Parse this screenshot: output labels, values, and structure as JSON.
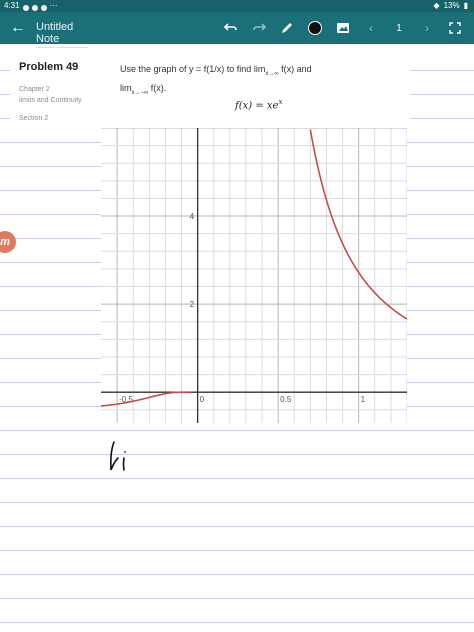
{
  "status_bar": {
    "time": "4:31",
    "battery": "13%"
  },
  "app_bar": {
    "title": "Untitled Note",
    "page_number": "1",
    "icons": [
      "back-arrow-icon",
      "undo-icon",
      "redo-icon",
      "pen-icon",
      "color-swatch",
      "image-icon",
      "prev-page-icon",
      "next-page-icon",
      "expand-icon"
    ],
    "colors": {
      "bar": "#1a6f78",
      "status": "#17626a",
      "ink": "#111111"
    }
  },
  "problem": {
    "title": "Problem 49",
    "chapter": "Chapter 2",
    "topic": "limits and Continuity",
    "section": "Section 2",
    "question_line1": "Use the graph of y = f(1/x) to find lim",
    "sub1": "x→∞",
    "mid1": "f(x) and",
    "question_line2": "lim",
    "sub2": "x→−∞",
    "end2": "f(x).",
    "formula": "f(x) = xe",
    "formula_sup": "x"
  },
  "chart_data": {
    "type": "line",
    "title": "",
    "xlabel": "",
    "ylabel": "",
    "xlim": [
      -0.6,
      1.3
    ],
    "ylim": [
      -0.7,
      6.0
    ],
    "grid": true,
    "x_ticks": [
      -0.5,
      0,
      0.5,
      1
    ],
    "x_tick_labels": [
      "-0.5",
      "0",
      "0.5",
      "1"
    ],
    "y_ticks": [
      2,
      4
    ],
    "y_tick_labels": [
      "2",
      "4"
    ],
    "series": [
      {
        "color": "#c0504d",
        "function": "(1/x)·e^(1/x)",
        "x": [
          -0.6,
          -0.5,
          -0.4,
          -0.3,
          -0.2,
          -0.1,
          -0.05,
          0.705,
          0.8,
          0.9,
          1.0,
          1.1,
          1.2,
          1.3
        ],
        "y": [
          -0.31,
          -0.27,
          -0.21,
          -0.12,
          -0.03,
          -0.0005,
          0.0,
          5.86,
          4.36,
          3.4,
          2.72,
          2.26,
          1.92,
          1.67
        ]
      }
    ]
  },
  "badge": {
    "letter": "m"
  },
  "handwriting": {
    "text": "li"
  }
}
